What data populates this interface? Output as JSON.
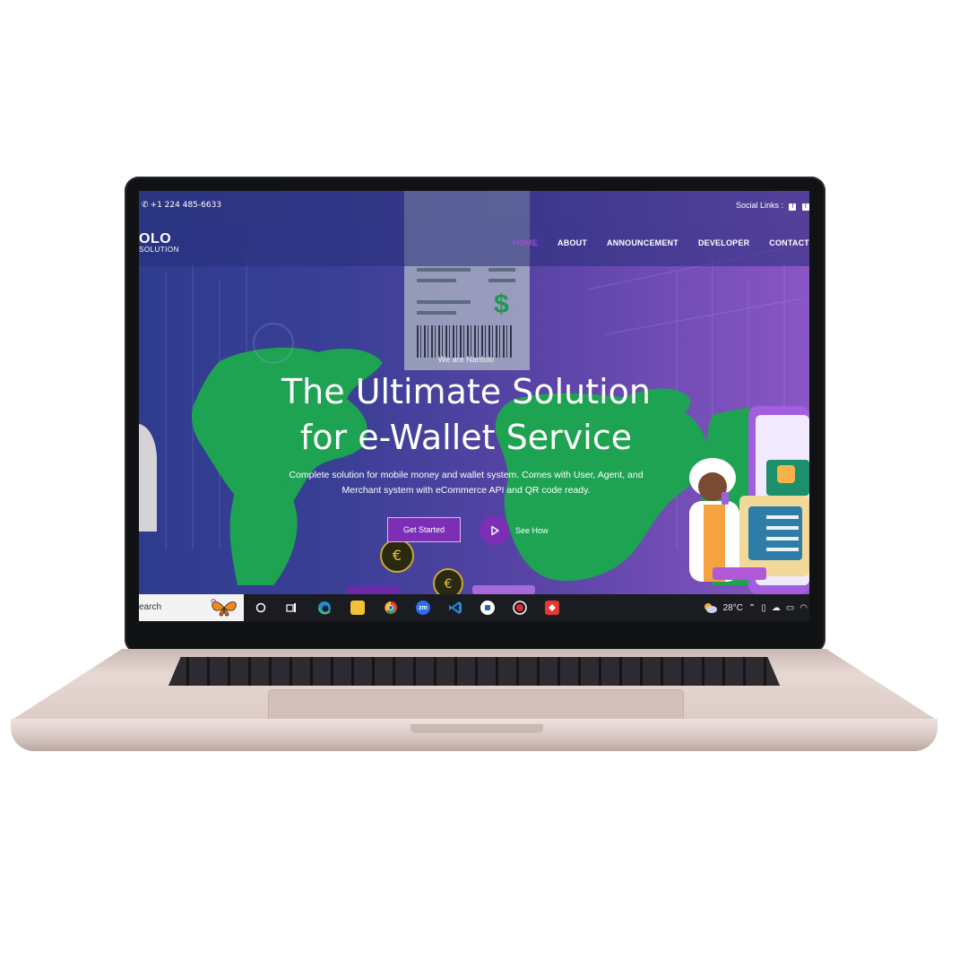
{
  "topbar": {
    "phone": "+1 224 485-6633",
    "social_label": "Social Links :",
    "social_icons": [
      "facebook-icon",
      "twitter-icon"
    ]
  },
  "nav": {
    "logo_line1": "OLO",
    "logo_line2": "SOLUTION",
    "items": [
      {
        "label": "HOME",
        "active": true
      },
      {
        "label": "ABOUT",
        "active": false
      },
      {
        "label": "ANNOUNCEMENT",
        "active": false
      },
      {
        "label": "DEVELOPER",
        "active": false
      },
      {
        "label": "CONTACT",
        "active": false
      }
    ]
  },
  "hero": {
    "eyebrow": "We are Nanfolo",
    "title_line1": "The Ultimate Solution",
    "title_line2": "for e-Wallet Service",
    "description": "Complete solution for mobile money and wallet system. Comes with User, Agent, and Merchant system with eCommerce API and QR code ready.",
    "primary_button": "Get Started",
    "secondary_button": "See How"
  },
  "receipt": {
    "currency_symbol": "$"
  },
  "taskbar": {
    "search_text": "earch",
    "weather": "28°C",
    "apps": [
      "cortana-icon",
      "task-view-icon",
      "edge-icon",
      "file-explorer-icon",
      "chrome-icon",
      "zoom-icon",
      "vscode-icon",
      "app-icon",
      "record-icon",
      "anydesk-icon"
    ],
    "zoom_label": "zm"
  },
  "colors": {
    "accent": "#7c2fb4",
    "nav_active": "#9a4fd0",
    "map_green": "#1ea352"
  }
}
